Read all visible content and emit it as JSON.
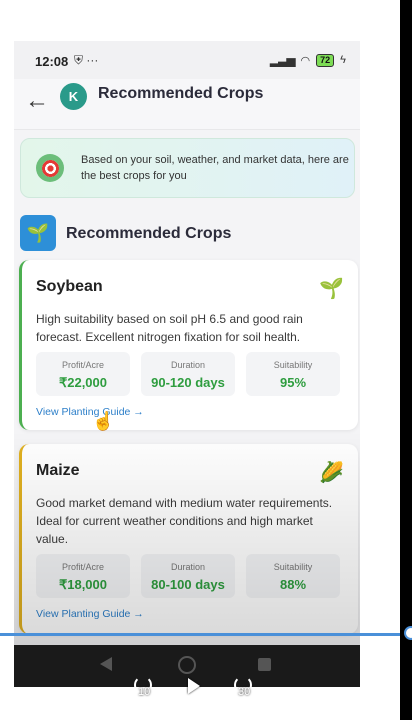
{
  "status": {
    "time": "12:08",
    "extra": "⛨ ···",
    "battery": "72"
  },
  "header": {
    "back_label": "←",
    "avatar_letter": "K",
    "title": "Recommended Crops"
  },
  "banner": {
    "text": "Based on your soil, weather, and market data, here are the best crops for you"
  },
  "section": {
    "icon": "🌱",
    "title": "Recommended Crops"
  },
  "labels": {
    "profit": "Profit/Acre",
    "duration": "Duration",
    "suitability": "Suitability",
    "guide": "View Planting Guide →"
  },
  "crops": [
    {
      "name": "Soybean",
      "emoji": "🌱",
      "description": "High suitability based on soil pH 6.5 and good rain forecast. Excellent nitrogen fixation for soil health.",
      "profit": "₹22,000",
      "duration": "90-120 days",
      "suitability": "95%"
    },
    {
      "name": "Maize",
      "emoji": "🌽",
      "description": "Good market demand with medium water requirements. Ideal for current weather conditions and high market value.",
      "profit": "₹18,000",
      "duration": "80-100 days",
      "suitability": "88%"
    }
  ],
  "video": {
    "rewind": "10",
    "forward": "30"
  },
  "colors": {
    "accent_green": "#2e9d3f",
    "link_blue": "#2d7fc9",
    "soy_border": "#4caf50",
    "maize_border": "#e0b020"
  }
}
